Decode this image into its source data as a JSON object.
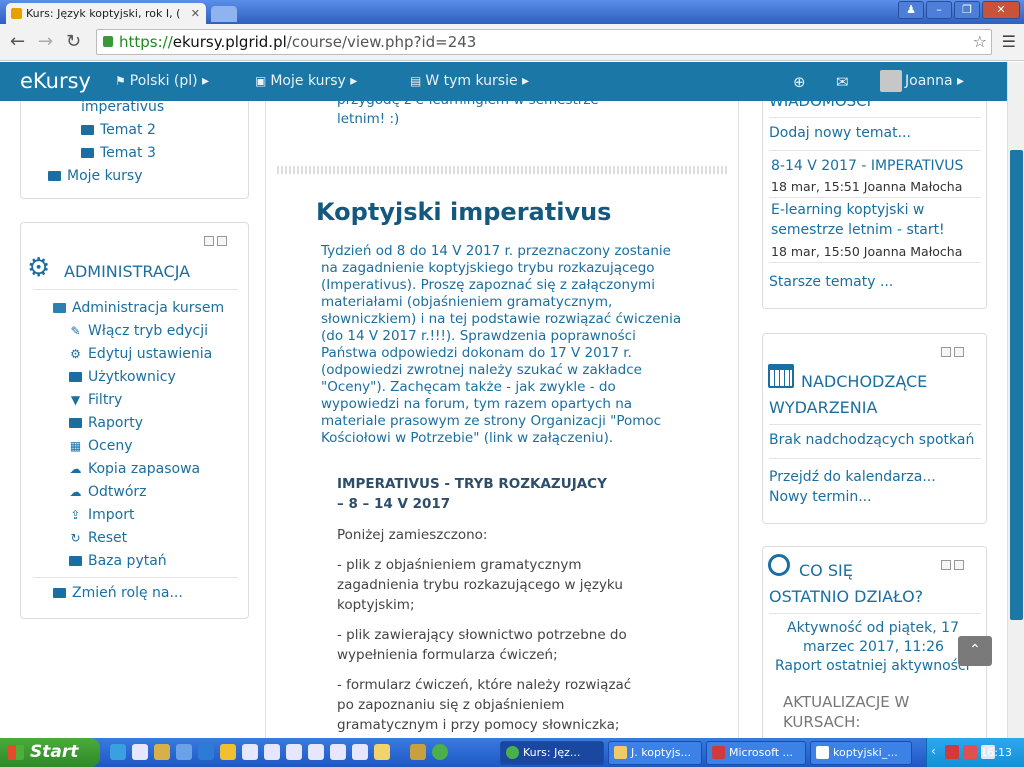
{
  "browser": {
    "tab_title": "Kurs: Język koptyjski, rok I, (",
    "url_scheme": "https://",
    "url_host": "ekursy.plgrid.pl",
    "url_path": "/course/view.php?id=243"
  },
  "navbar": {
    "brand": "eKursy",
    "language": "Polski (pl)",
    "my_courses": "Moje kursy",
    "this_course": "W tym kursie",
    "user": "Joanna"
  },
  "left_nav": {
    "items": [
      "imperativus",
      "Temat 2",
      "Temat 3",
      "Moje kursy"
    ]
  },
  "admin": {
    "title": "ADMINISTRACJA",
    "course_admin": "Administracja kursem",
    "items": [
      "Włącz tryb edycji",
      "Edytuj ustawienia",
      "Użytkownicy",
      "Filtry",
      "Raporty",
      "Oceny",
      "Kopia zapasowa",
      "Odtwórz",
      "Import",
      "Reset",
      "Baza pytań"
    ],
    "switch_role": "Zmień rolę na..."
  },
  "main": {
    "top_text_1": "przygodę z e-learningiem w semestrze",
    "top_text_2": "letnim! :)",
    "section_title": "Koptyjski imperativus",
    "summary_lines": [
      "Tydzień od 8 do 14 V 2017 r. przeznaczony zostanie",
      "na zagadnienie koptyjskiego trybu rozkazującego",
      "(Imperativus). Proszę zapoznać się z załączonymi",
      "materiałami (objaśnieniem gramatycznym,",
      "słowniczkiem) i na tej podstawie rozwiązać ćwiczenia",
      "(do 14 V 2017 r.!!!). Sprawdzenia poprawności",
      "Państwa odpowiedzi dokonam do 17 V 2017 r.",
      "(odpowiedzi zwrotnej należy szukać w zakładce",
      "\"Oceny\"). Zachęcam także - jak zwykle - do",
      "wypowiedzi na forum, tym razem opartych na",
      "materiale prasowym ze strony Organizacji \"Pomoc",
      "Kościołowi w Potrzebie\" (link w załączeniu)."
    ],
    "heading_line1": "IMPERATIVUS - TRYB ROZKAZUJACY",
    "heading_line2": "– 8 – 14 V 2017",
    "intro": "Poniżej zamieszczono:",
    "bullet1": [
      "- plik z objaśnieniem gramatycznym",
      "zagadnienia trybu rozkazującego w języku",
      "koptyjskim;"
    ],
    "bullet2": [
      "- plik zawierający słownictwo potrzebne do",
      "wypełnienia formularza ćwiczeń;"
    ],
    "bullet3": [
      "- formularz ćwiczeń, które należy rozwiązać",
      "po zapoznaniu się z objaśnieniem",
      "gramatycznym i przy pomocy słowniczka;"
    ]
  },
  "news": {
    "title_partial": "WIADOMOŚCI",
    "add_topic": "Dodaj nowy temat...",
    "post1_title": "8-14 V 2017 - IMPERATIVUS",
    "post1_meta": "18 mar, 15:51 Joanna Małocha",
    "post2_title_1": "E-learning koptyjski w",
    "post2_title_2": "semestrze letnim - start!",
    "post2_meta": "18 mar, 15:50 Joanna Małocha",
    "older": "Starsze tematy ..."
  },
  "events": {
    "title_1": "NADCHODZĄCE",
    "title_2": "WYDARZENIA",
    "none": "Brak nadchodzących spotkań",
    "go_calendar": "Przejdź do kalendarza...",
    "new_event": "Nowy termin..."
  },
  "recent": {
    "title_1": "CO SIĘ",
    "title_2": "OSTATNIO DZIAŁO?",
    "since_1": "Aktywność od piątek, 17",
    "since_2": "marzec 2017, 11:26",
    "report": "Raport ostatniej aktywności",
    "updates_1": "AKTUALIZACJE W",
    "updates_2": "KURSACH:"
  },
  "taskbar": {
    "start": "Start",
    "tasks": [
      "Kurs: Jęz...",
      "J. koptyjs...",
      "Microsoft ...",
      "koptyjski_..."
    ],
    "clock": "16:13"
  }
}
